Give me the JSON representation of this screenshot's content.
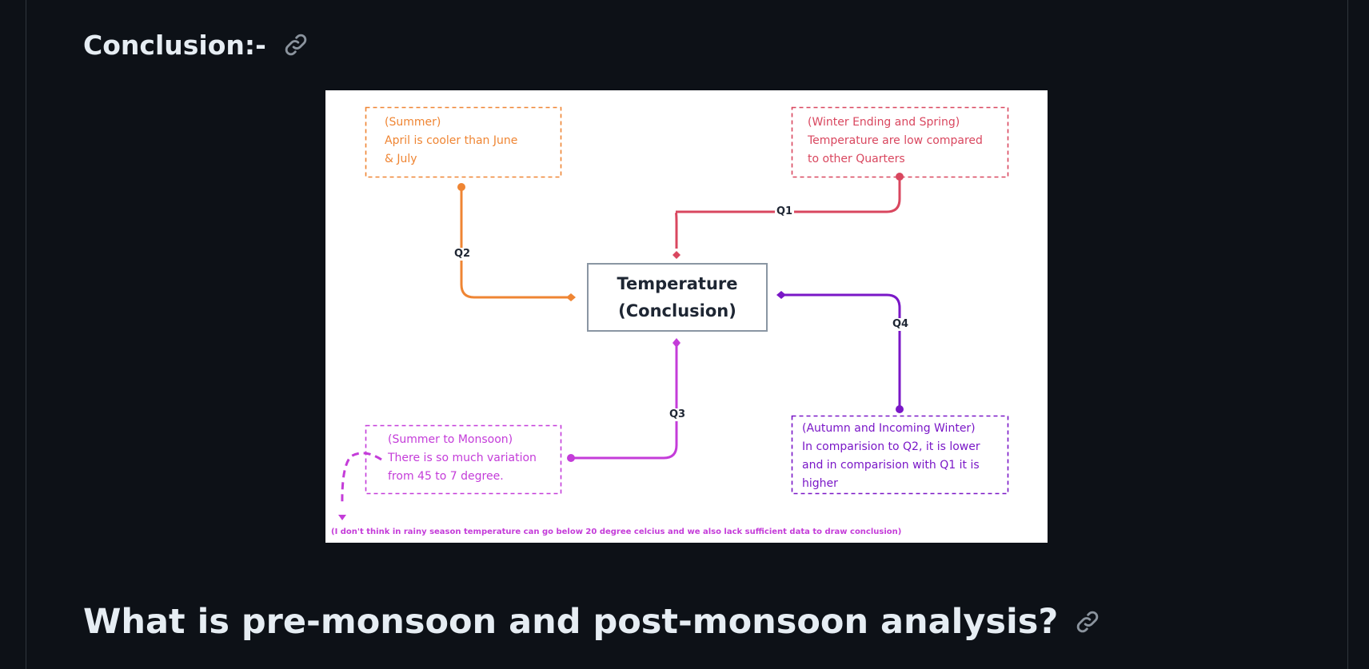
{
  "headings": {
    "conclusion": "Conclusion:-",
    "question": "What is pre-monsoon and post-monsoon analysis?"
  },
  "icons": {
    "anchor": "link-icon"
  },
  "diagram": {
    "center": {
      "line1": "Temperature",
      "line2": "(Conclusion)"
    },
    "quarters": {
      "q1": "Q1",
      "q2": "Q2",
      "q3": "Q3",
      "q4": "Q4"
    },
    "notes": {
      "summer": {
        "line1": "(Summer)",
        "line2": "April is cooler than June",
        "line3": "& July"
      },
      "winter_spring": {
        "line1": "(Winter Ending and Spring)",
        "line2": "Temperature are low compared",
        "line3": "to other Quarters"
      },
      "monsoon": {
        "line1": "(Summer to Monsoon)",
        "line2": "There is so much variation",
        "line3": "from 45 to 7 degree."
      },
      "autumn": {
        "line1": "(Autumn and Incoming Winter)",
        "line2": "In comparision to Q2, it is lower",
        "line3": "and in comparision with Q1 it is",
        "line4": "higher"
      }
    },
    "footnote": "(I don't think in rainy season temperature can go below 20 degree celcius and we also lack sufficient data to draw conclusion)"
  },
  "colors": {
    "background": "#0d1117",
    "heading": "#e6edf3",
    "border": "#30363d",
    "q1": "#d9475f",
    "q2": "#ef8533",
    "q3": "#c43cd9",
    "q4": "#7a17c7",
    "center_border": "#8a96a3"
  }
}
